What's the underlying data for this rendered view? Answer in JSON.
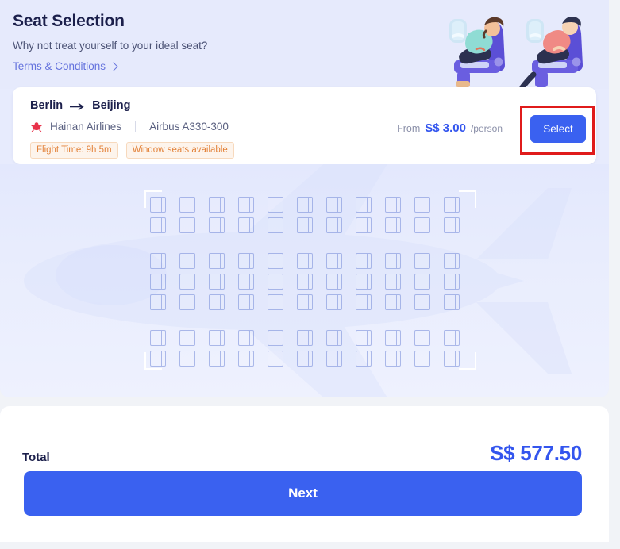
{
  "header": {
    "title": "Seat Selection",
    "subtitle": "Why not treat yourself to your ideal seat?",
    "terms_link": "Terms & Conditions"
  },
  "flight": {
    "origin": "Berlin",
    "destination": "Beijing",
    "airline": "Hainan Airlines",
    "aircraft": "Airbus A330-300",
    "badges": [
      "Flight Time: 9h 5m",
      "Window seats available"
    ],
    "price_from_label": "From",
    "price_amount": "S$ 3.00",
    "price_unit": "/person",
    "select_label": "Select"
  },
  "seatmap": {
    "columns": 11,
    "blocks": [
      2,
      3,
      2
    ],
    "total_seats": 77
  },
  "summary": {
    "total_label": "Total",
    "total_amount": "S$ 577.50",
    "next_label": "Next"
  },
  "colors": {
    "accent_blue": "#3a61f0",
    "price_blue": "#3355ee",
    "link_blue": "#6573dd",
    "badge_orange": "#e3833b",
    "header_bg": "#e6eafc",
    "highlight_red": "#e01b1b"
  }
}
